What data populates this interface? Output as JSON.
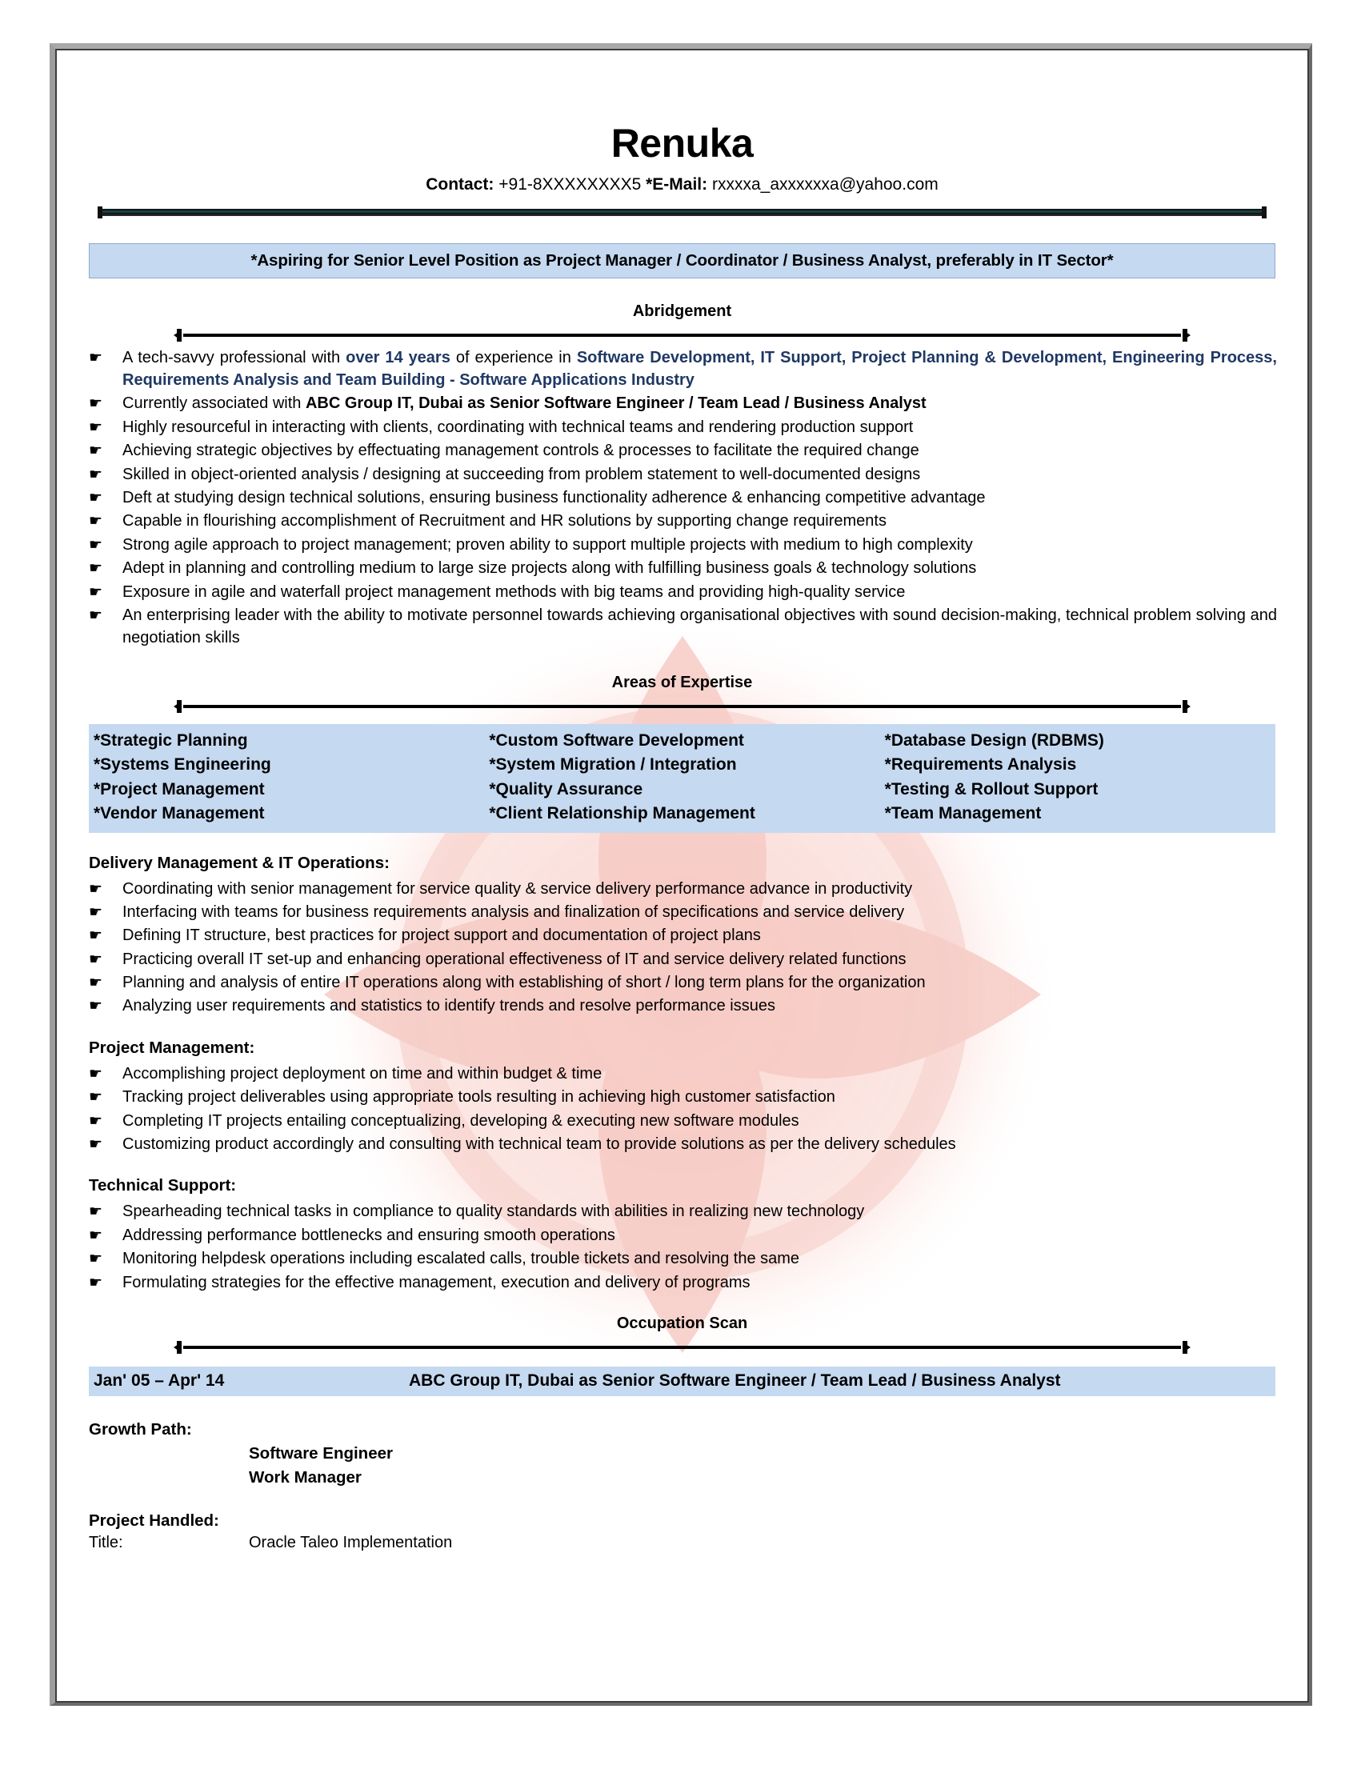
{
  "document": {
    "name": "Renuka",
    "contact_label": "Contact:",
    "contact_value": "+91-8XXXXXXXX5",
    "email_label": "*E-Mail:",
    "email_value": "rxxxxa_axxxxxxa@yahoo.com",
    "objective": "*Aspiring for Senior Level Position as Project Manager / Coordinator / Business Analyst, preferably in IT Sector*"
  },
  "colors": {
    "band_blue": "#c5d9f1",
    "navy_text": "#1f3864",
    "watermark_pink": "#f7c6c0"
  },
  "icons": {
    "bullet": "bullet-hand-icon"
  },
  "abridgement": {
    "heading": "Abridgement",
    "bullets": [
      {
        "parts": [
          {
            "text": "A tech-savvy professional with ",
            "style": "plain"
          },
          {
            "text": "over 14 years",
            "style": "navy"
          },
          {
            "text": " of experience in ",
            "style": "plain"
          },
          {
            "text": "Software Development, IT Support, Project Planning & Development, Engineering Process, Requirements Analysis and Team Building - Software Applications Industry",
            "style": "navy"
          }
        ]
      },
      {
        "parts": [
          {
            "text": "Currently associated with ",
            "style": "plain"
          },
          {
            "text": "ABC Group IT, Dubai as Senior Software Engineer / Team Lead / Business Analyst",
            "style": "bold"
          }
        ]
      },
      {
        "parts": [
          {
            "text": "Highly resourceful in interacting with clients, coordinating with technical teams and rendering production support",
            "style": "plain"
          }
        ]
      },
      {
        "parts": [
          {
            "text": "Achieving strategic objectives by effectuating management controls & processes to facilitate the required change",
            "style": "plain"
          }
        ]
      },
      {
        "parts": [
          {
            "text": "Skilled in object-oriented analysis / designing at succeeding from problem statement to well-documented designs",
            "style": "plain"
          }
        ]
      },
      {
        "parts": [
          {
            "text": "Deft at studying design technical solutions, ensuring business functionality adherence & enhancing competitive advantage",
            "style": "plain"
          }
        ]
      },
      {
        "parts": [
          {
            "text": "Capable in flourishing accomplishment of Recruitment and HR solutions by supporting change requirements",
            "style": "plain"
          }
        ]
      },
      {
        "parts": [
          {
            "text": "Strong agile approach to project management; proven ability to support multiple projects with medium to high complexity",
            "style": "plain"
          }
        ]
      },
      {
        "parts": [
          {
            "text": "Adept in planning and controlling medium to large size projects along with fulfilling business goals & technology solutions",
            "style": "plain"
          }
        ]
      },
      {
        "parts": [
          {
            "text": "Exposure in agile and waterfall project management methods with big teams and providing high-quality service",
            "style": "plain"
          }
        ]
      },
      {
        "parts": [
          {
            "text": "An enterprising leader with the ability to motivate personnel towards achieving organisational objectives with sound decision-making, technical problem solving and negotiation skills",
            "style": "plain"
          }
        ]
      }
    ]
  },
  "expertise": {
    "heading": "Areas of Expertise",
    "columns": [
      [
        "*Strategic Planning",
        "*Systems Engineering",
        "*Project Management",
        "*Vendor Management"
      ],
      [
        "*Custom Software Development",
        "*System Migration / Integration",
        "*Quality Assurance",
        "*Client Relationship Management"
      ],
      [
        "*Database Design (RDBMS)",
        "*Requirements Analysis",
        "*Testing & Rollout Support",
        "*Team Management"
      ]
    ]
  },
  "delivery": {
    "heading": "Delivery Management & IT Operations:",
    "bullets": [
      "Coordinating with senior management for service quality & service delivery performance advance in productivity",
      "Interfacing with teams for business requirements analysis and finalization of specifications and service delivery",
      "Defining IT structure, best practices for project support and documentation of project plans",
      "Practicing overall IT set-up and enhancing operational effectiveness of IT and service delivery related functions",
      "Planning and analysis of entire IT operations along with establishing of short / long term plans for the organization",
      "Analyzing user requirements and statistics to identify trends and resolve performance issues"
    ]
  },
  "project_management": {
    "heading": "Project Management:",
    "bullets": [
      "Accomplishing project deployment on time and within budget & time",
      "Tracking project deliverables using appropriate tools resulting in achieving high customer satisfaction",
      "Completing IT projects entailing conceptualizing, developing & executing new software modules",
      "Customizing product accordingly and consulting with technical team to provide solutions as per the delivery schedules"
    ]
  },
  "technical_support": {
    "heading": "Technical Support:",
    "bullets": [
      "Spearheading technical tasks in compliance to quality standards with abilities in realizing new technology",
      "Addressing performance bottlenecks and ensuring smooth operations",
      "Monitoring helpdesk operations including escalated calls, trouble tickets and resolving the same",
      "Formulating strategies for the effective management, execution and delivery of programs"
    ]
  },
  "occupation": {
    "heading": "Occupation Scan",
    "period": "Jan' 05 – Apr' 14",
    "role": "ABC Group IT, Dubai as Senior Software Engineer / Team Lead / Business Analyst",
    "growth_path_label": "Growth Path:",
    "growth_path": [
      "Software Engineer",
      "Work Manager"
    ],
    "project_handled_label": "Project Handled:",
    "title_label": "Title:",
    "title_value": "Oracle Taleo Implementation"
  }
}
